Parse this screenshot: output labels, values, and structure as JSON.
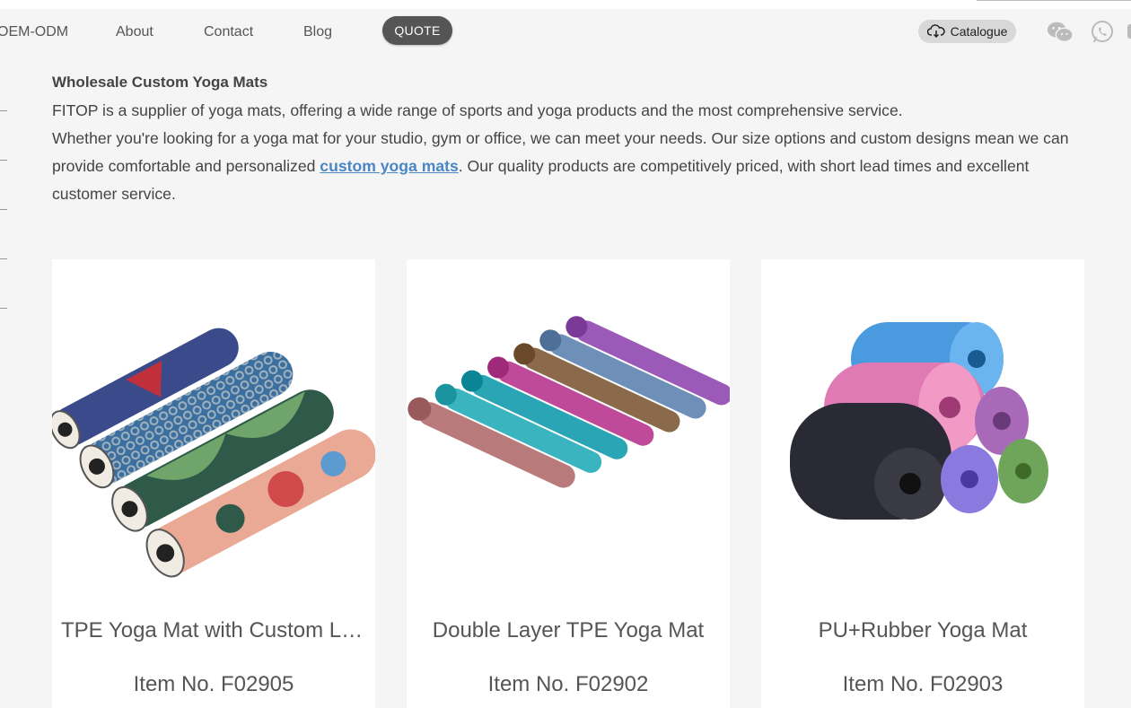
{
  "nav": {
    "items": [
      {
        "label": "OEM-ODM"
      },
      {
        "label": "About"
      },
      {
        "label": "Contact"
      },
      {
        "label": "Blog"
      }
    ],
    "quote_label": "QUOTE",
    "catalogue_label": "Catalogue",
    "icons": [
      "cloud-download-icon",
      "wechat-icon",
      "whatsapp-icon"
    ]
  },
  "intro": {
    "heading": "Wholesale Custom Yoga Mats",
    "para1": "FITOP is a supplier of yoga mats, offering a wide range of sports and yoga products and the most comprehensive service.",
    "para2_before": "Whether you're looking for a yoga mat for your studio, gym or office, we can meet your needs. Our size options and custom designs mean we can provide comfortable and personalized ",
    "para2_link": "custom yoga mats",
    "para2_after": ". Our quality products are competitively priced, with short lead times and excellent customer service."
  },
  "products": [
    {
      "title": "TPE Yoga Mat with Custom Logo",
      "item_no": "Item No. F02905"
    },
    {
      "title": "Double Layer TPE Yoga Mat",
      "item_no": "Item No. F02902"
    },
    {
      "title": "PU+Rubber Yoga Mat",
      "item_no": "Item No. F02903"
    }
  ],
  "colors": {
    "quote_bg": "#555555",
    "catalogue_bg": "#d8d8d8",
    "link": "#4a86c5",
    "page_bg": "#f5f5f5"
  }
}
